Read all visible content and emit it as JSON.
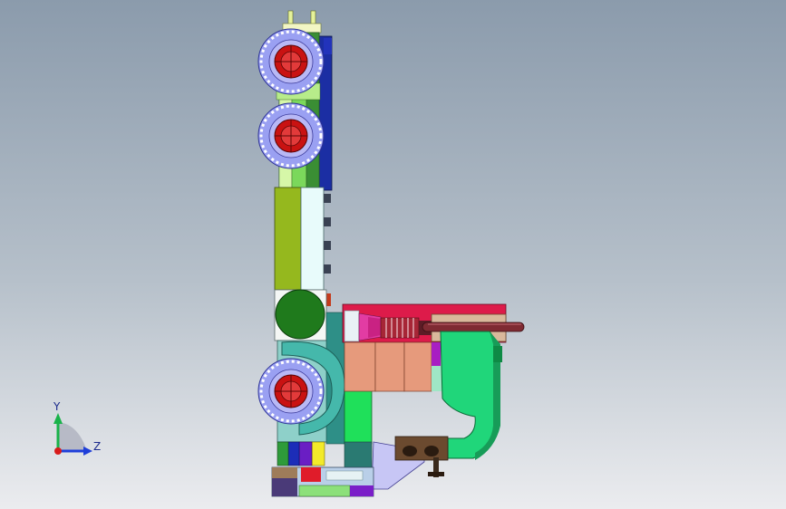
{
  "viewport": {
    "background_top": "#8b9bac",
    "background_bottom": "#ebecef"
  },
  "triad": {
    "y_label": "Y",
    "z_label": "Z",
    "y_color": "#19b34a",
    "z_color": "#1f3fd9",
    "x_color": "#d81b1b"
  },
  "model": {
    "icons": [
      "roller-wheel-icon",
      "roller-wheel-icon",
      "roller-wheel-icon"
    ]
  }
}
